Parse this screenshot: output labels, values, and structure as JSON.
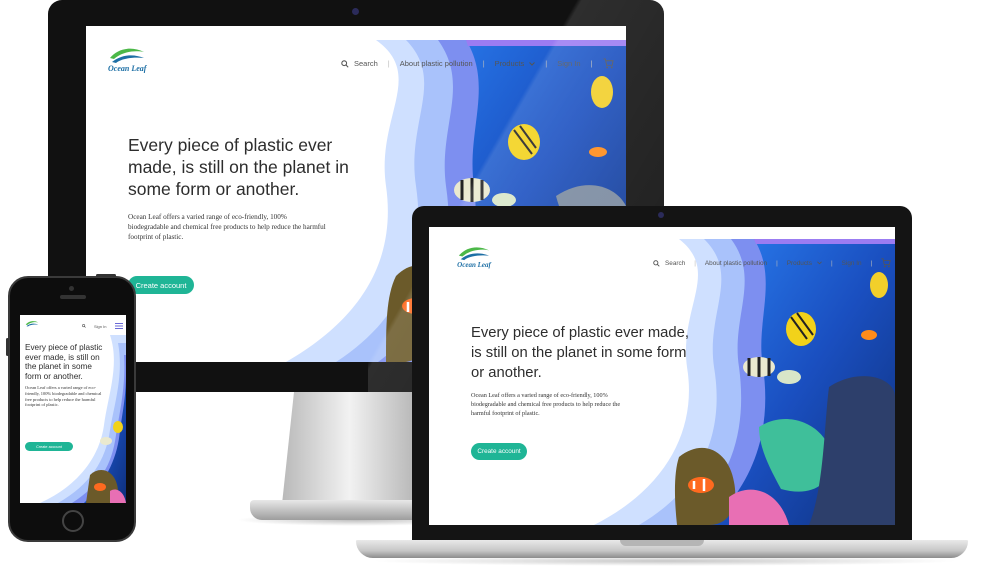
{
  "site": {
    "logo_text": "Ocean Leaf",
    "nav": {
      "search": "Search",
      "about": "About plastic pollution",
      "products": "Products",
      "sign_in": "Sign In"
    },
    "headline": "Every piece of plastic ever made, is still on the planet in some form or another.",
    "body": "Ocean Leaf offers a varied range of eco-friendly, 100% biodegradable and chemical free products to help reduce the harmful footprint of plastic.",
    "cta": "Create account"
  },
  "icons": {
    "search": "search-icon",
    "chevron": "chevron-down-icon",
    "cart": "cart-icon",
    "menu": "hamburger-menu-icon",
    "logo": "leaf-wave-logo"
  },
  "colors": {
    "cta": "#1fb596",
    "wave_light": "#cfe0ff",
    "wave_mid": "#a9c2fb",
    "wave_dark": "#7d8ff0",
    "wave_violet": "#9b7cf2",
    "ocean": "#1e5fd0",
    "logo_blue": "#1d6fa5",
    "logo_green": "#4cb848"
  }
}
